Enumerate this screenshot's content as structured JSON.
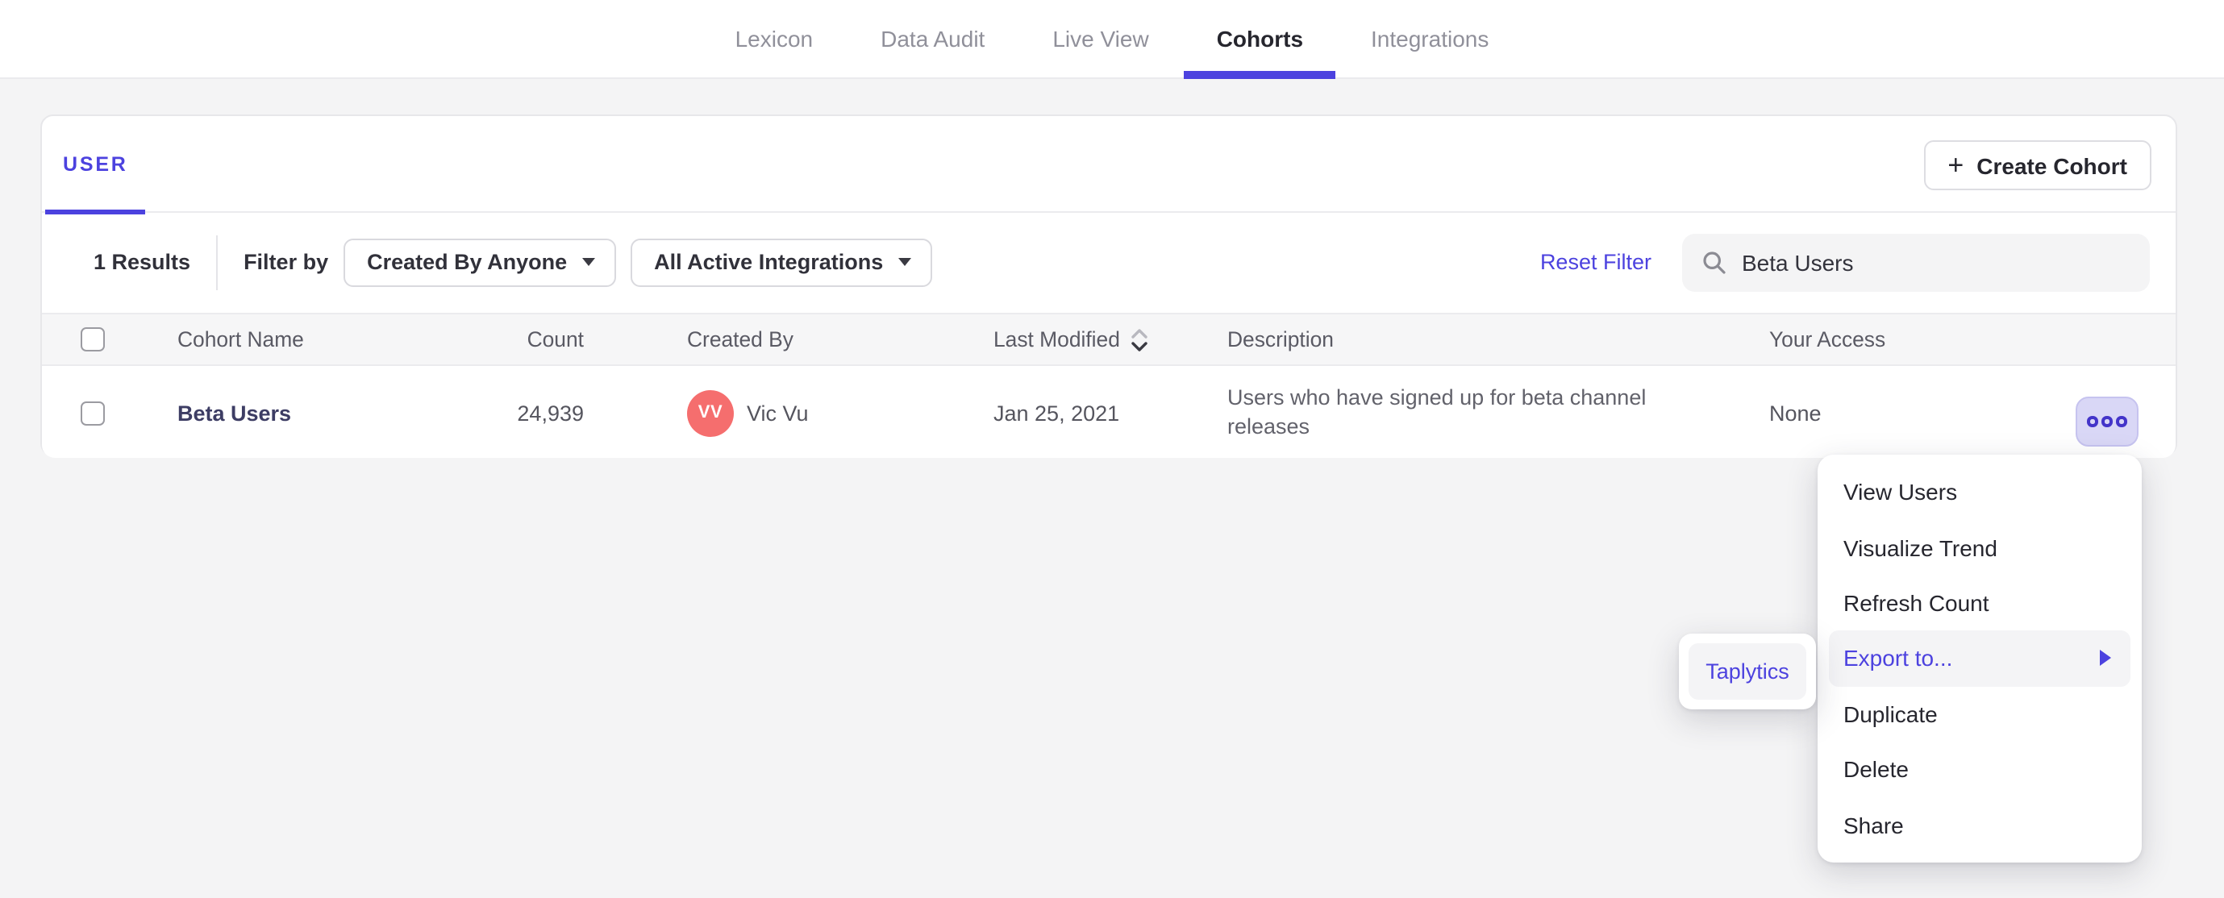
{
  "colors": {
    "accent": "#4C42DF",
    "accent_deep": "#4334C9",
    "avatar": "#F56E6E",
    "link_dark": "#3D3D64"
  },
  "nav": {
    "tabs": [
      {
        "label": "Lexicon",
        "active": false
      },
      {
        "label": "Data Audit",
        "active": false
      },
      {
        "label": "Live View",
        "active": false
      },
      {
        "label": "Cohorts",
        "active": true
      },
      {
        "label": "Integrations",
        "active": false
      }
    ]
  },
  "header": {
    "type_tab": "USER",
    "plus_icon": "+",
    "create_button": "Create Cohort"
  },
  "filterbar": {
    "results_count": "1 Results",
    "filter_by_label": "Filter by",
    "created_by_dropdown": "Created By Anyone",
    "integrations_dropdown": "All Active Integrations",
    "reset_filter": "Reset Filter",
    "search_value": "Beta Users"
  },
  "table": {
    "columns": {
      "name": "Cohort Name",
      "count": "Count",
      "created_by": "Created By",
      "last_modified": "Last Modified",
      "description": "Description",
      "access": "Your Access"
    },
    "rows": [
      {
        "name": "Beta Users",
        "count": "24,939",
        "avatar_initials": "VV",
        "created_by": "Vic Vu",
        "last_modified": "Jan 25, 2021",
        "description": "Users who have signed up for beta channel releases",
        "access": "None"
      }
    ]
  },
  "context_menu": {
    "items": [
      "View Users",
      "Visualize Trend",
      "Refresh Count",
      "Export to...",
      "Duplicate",
      "Delete",
      "Share"
    ],
    "highlighted_item": "Export to...",
    "submenu": {
      "items": [
        "Taplytics"
      ]
    }
  }
}
